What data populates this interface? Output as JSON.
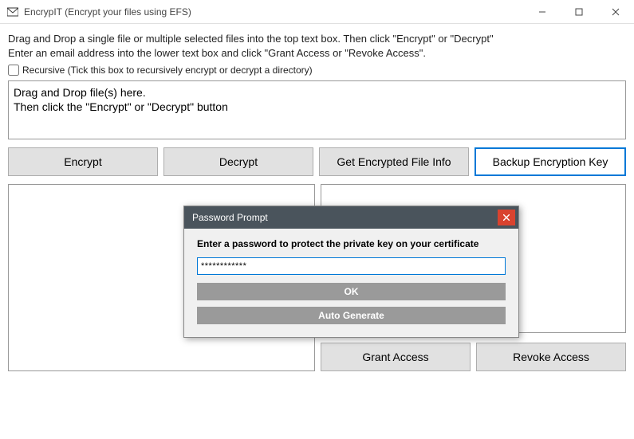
{
  "window": {
    "title": "EncrypIT (Encrypt your files using EFS)"
  },
  "instructions": {
    "line1": "Drag and Drop a single file or multiple selected files into the top text box. Then click \"Encrypt\" or \"Decrypt\"",
    "line2": "Enter an email address into the lower text box and click \"Grant Access or \"Revoke Access\"."
  },
  "checkbox": {
    "label": "Recursive (Tick this box to recursively encrypt or decrypt a directory)",
    "checked": false
  },
  "dropzone": {
    "line1": "Drag and Drop file(s) here.",
    "line2": "Then click the \"Encrypt\" or \"Decrypt\" button"
  },
  "buttons": {
    "encrypt": "Encrypt",
    "decrypt": "Decrypt",
    "get_info": "Get Encrypted File Info",
    "backup_key": "Backup Encryption Key",
    "grant": "Grant Access",
    "revoke": "Revoke Access"
  },
  "modal": {
    "title": "Password Prompt",
    "label": "Enter a password to protect the private key on your certificate",
    "password_value": "************",
    "ok": "OK",
    "auto": "Auto Generate"
  }
}
